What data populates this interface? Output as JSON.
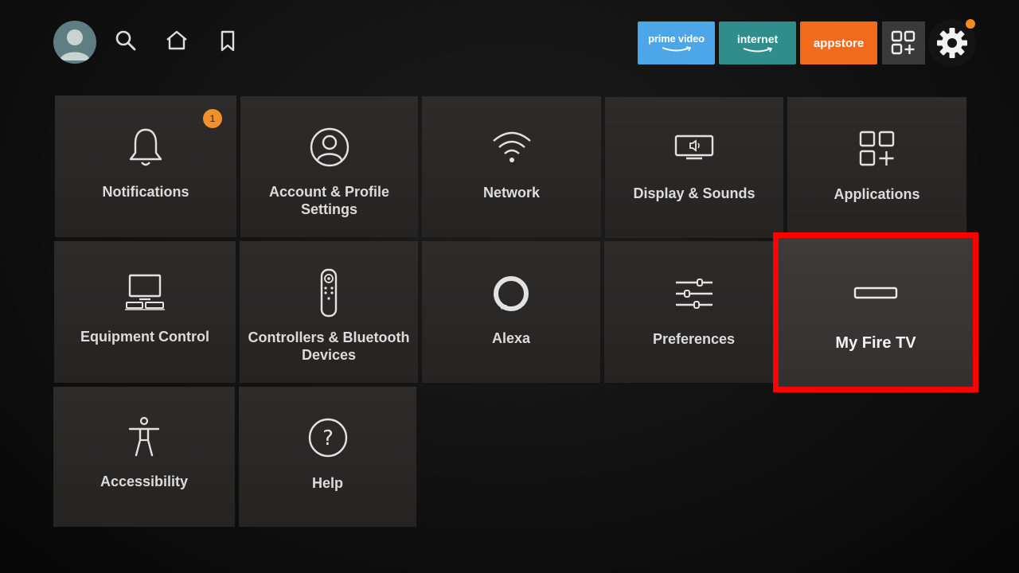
{
  "topbar": {
    "apps": [
      {
        "label": "prime video",
        "color": "#4da6e8"
      },
      {
        "label": "internet",
        "color": "#2f8e8c"
      },
      {
        "label": "appstore",
        "color": "#f26b1d"
      }
    ],
    "icons": [
      "profile-avatar",
      "search-icon",
      "home-icon",
      "bookmark-icon",
      "app-grid-icon",
      "gear-icon"
    ]
  },
  "settings_tiles": [
    {
      "label": "Notifications",
      "icon": "bell-icon",
      "badge": "1"
    },
    {
      "label": "Account & Profile Settings",
      "icon": "account-icon"
    },
    {
      "label": "Network",
      "icon": "wifi-icon"
    },
    {
      "label": "Display & Sounds",
      "icon": "display-icon"
    },
    {
      "label": "Applications",
      "icon": "applications-icon"
    },
    {
      "label": "Equipment Control",
      "icon": "equipment-icon"
    },
    {
      "label": "Controllers & Bluetooth Devices",
      "icon": "remote-icon"
    },
    {
      "label": "Alexa",
      "icon": "alexa-icon"
    },
    {
      "label": "Preferences",
      "icon": "sliders-icon"
    },
    {
      "label": "My Fire TV",
      "icon": "fire-tv-device-icon",
      "focused": true
    },
    {
      "label": "Accessibility",
      "icon": "accessibility-icon"
    },
    {
      "label": "Help",
      "icon": "help-icon"
    }
  ],
  "colors": {
    "highlight": "#ff0000",
    "badge": "#f0912d",
    "notification_dot": "#f58a1f"
  }
}
